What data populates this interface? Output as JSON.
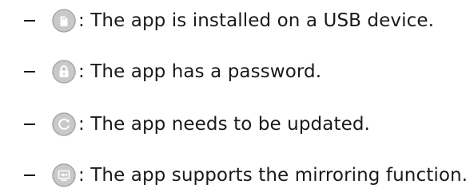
{
  "legend": {
    "items": [
      {
        "icon": "usb-icon",
        "text": ": The app is installed on a USB device."
      },
      {
        "icon": "lock-icon",
        "text": ": The app has a password."
      },
      {
        "icon": "update-icon",
        "text": ": The app needs to be updated."
      },
      {
        "icon": "mirroring-icon",
        "text": ": The app supports the mirroring function."
      }
    ],
    "bullet": "–"
  },
  "colors": {
    "icon_fill": "#c9c9c9",
    "icon_stroke": "#a6a6a6",
    "icon_glyph": "#ffffff",
    "text": "#1a1a1a"
  }
}
